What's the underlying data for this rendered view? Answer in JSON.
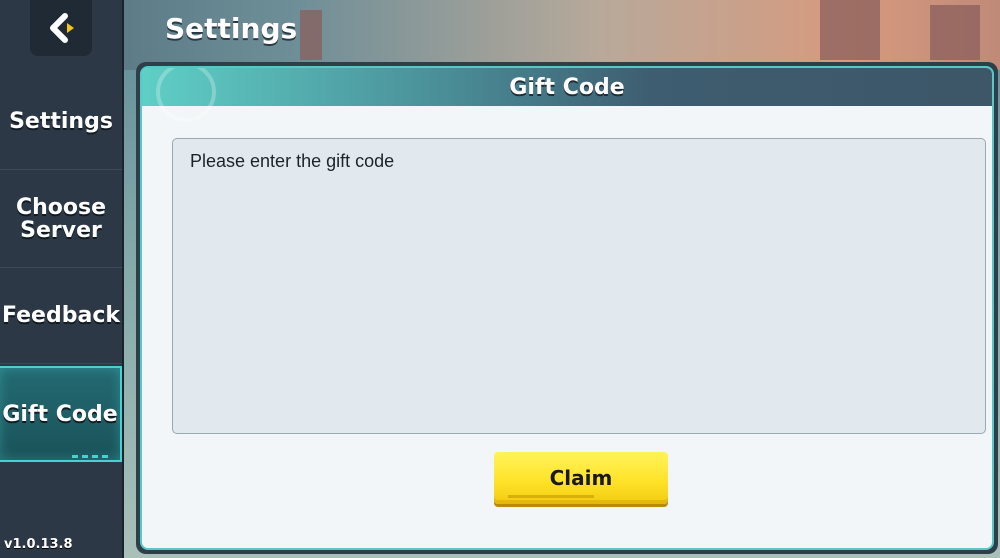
{
  "header": {
    "title": "Settings"
  },
  "sidebar": {
    "items": [
      {
        "label": "Settings"
      },
      {
        "label": "Choose Server"
      },
      {
        "label": "Feedback"
      },
      {
        "label": "Gift Code"
      }
    ],
    "active_index": 3,
    "version": "v1.0.13.8"
  },
  "panel": {
    "title": "Gift Code",
    "input": {
      "placeholder": "Please enter the gift code",
      "value": ""
    },
    "claim_label": "Claim"
  },
  "colors": {
    "accent": "#48d0d2",
    "button": "#ffe32a",
    "sidebar": "#2c3845"
  },
  "icons": {
    "back": "back-arrow-icon"
  }
}
